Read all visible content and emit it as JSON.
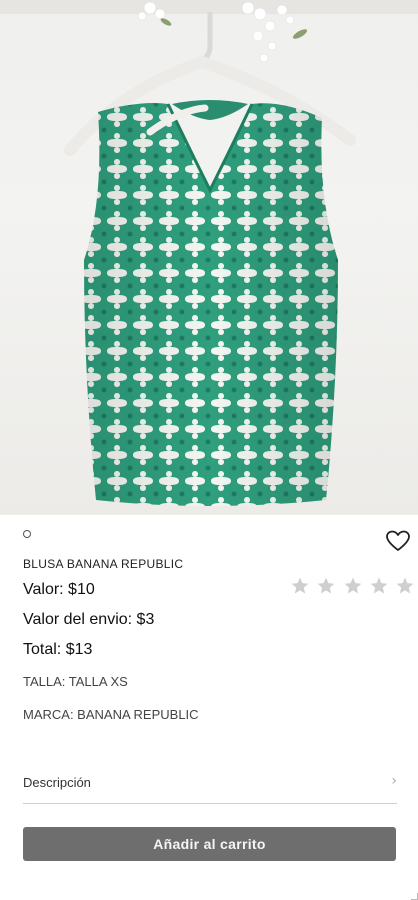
{
  "product": {
    "image_alt": "blusa verde con patrón geométrico en percha",
    "title": "BLUSA BANANA REPUBLIC",
    "price": "Valor: $10",
    "shipping": "Valor del envio: $3",
    "total": "Total: $13",
    "size": "TALLA: TALLA XS",
    "brand": "MARCA: BANANA REPUBLIC",
    "rating": {
      "value": 0,
      "max": 5
    }
  },
  "sections": {
    "description_label": "Descripción"
  },
  "actions": {
    "add_to_cart": "Añadir al carrito",
    "favorite_icon": "heart-icon",
    "chevron_icon": "chevron-right-icon"
  },
  "colors": {
    "button_bg": "#6e6e6e",
    "star_empty": "#cfcfcf",
    "fabric_green": "#2f9f7e"
  }
}
